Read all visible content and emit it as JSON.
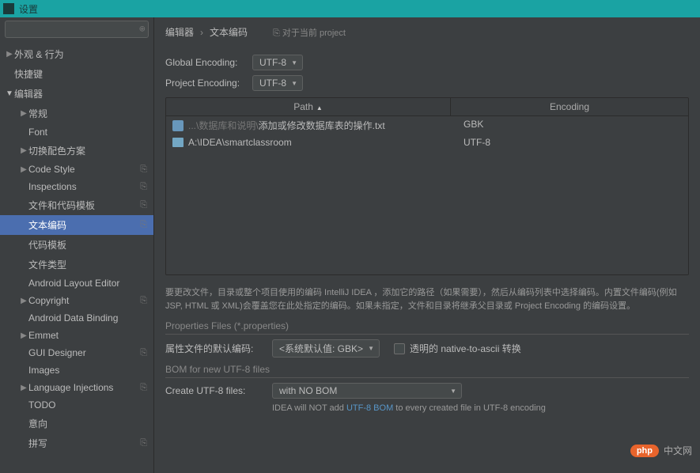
{
  "window": {
    "title": "设置"
  },
  "search": {
    "placeholder": ""
  },
  "tree": [
    {
      "label": "外观 & 行为",
      "level": 0,
      "expand": "right",
      "copy": false
    },
    {
      "label": "快捷键",
      "level": 0,
      "expand": "none",
      "copy": false
    },
    {
      "label": "编辑器",
      "level": 0,
      "expand": "down",
      "copy": false
    },
    {
      "label": "常规",
      "level": 1,
      "expand": "right",
      "copy": false
    },
    {
      "label": "Font",
      "level": 1,
      "expand": "none",
      "copy": false
    },
    {
      "label": "切换配色方案",
      "level": 1,
      "expand": "right",
      "copy": false
    },
    {
      "label": "Code Style",
      "level": 1,
      "expand": "right",
      "copy": true
    },
    {
      "label": "Inspections",
      "level": 1,
      "expand": "none",
      "copy": true
    },
    {
      "label": "文件和代码模板",
      "level": 1,
      "expand": "none",
      "copy": true
    },
    {
      "label": "文本编码",
      "level": 1,
      "expand": "none",
      "copy": true,
      "selected": true
    },
    {
      "label": "代码模板",
      "level": 1,
      "expand": "none",
      "copy": false
    },
    {
      "label": "文件类型",
      "level": 1,
      "expand": "none",
      "copy": false
    },
    {
      "label": "Android Layout Editor",
      "level": 1,
      "expand": "none",
      "copy": false
    },
    {
      "label": "Copyright",
      "level": 1,
      "expand": "right",
      "copy": true
    },
    {
      "label": "Android Data Binding",
      "level": 1,
      "expand": "none",
      "copy": false
    },
    {
      "label": "Emmet",
      "level": 1,
      "expand": "right",
      "copy": false
    },
    {
      "label": "GUI Designer",
      "level": 1,
      "expand": "none",
      "copy": true
    },
    {
      "label": "Images",
      "level": 1,
      "expand": "none",
      "copy": false
    },
    {
      "label": "Language Injections",
      "level": 1,
      "expand": "right",
      "copy": true
    },
    {
      "label": "TODO",
      "level": 1,
      "expand": "none",
      "copy": false
    },
    {
      "label": "意向",
      "level": 1,
      "expand": "none",
      "copy": false
    },
    {
      "label": "拼写",
      "level": 1,
      "expand": "none",
      "copy": true
    }
  ],
  "breadcrumb": {
    "root": "编辑器",
    "leaf": "文本编码",
    "scope": "对于当前 project"
  },
  "encodings": {
    "global_label": "Global Encoding:",
    "global_value": "UTF-8",
    "project_label": "Project Encoding:",
    "project_value": "UTF-8"
  },
  "table": {
    "col_path": "Path",
    "col_enc": "Encoding",
    "rows": [
      {
        "icon": "file",
        "prefix": "...\\数据库和说明\\",
        "name": "添加或修改数据库表的操作.txt",
        "enc": "GBK"
      },
      {
        "icon": "folder",
        "prefix": "",
        "name": "A:\\IDEA\\smartclassroom",
        "enc": "UTF-8"
      }
    ]
  },
  "hint": "要更改文件，目录或整个项目使用的编码 IntelliJ IDEA ，添加它的路径（如果需要），然后从编码列表中选择编码。内置文件编码(例如 JSP, HTML 或 XML)会覆盖您在此处指定的编码。如果未指定，文件和目录将继承父目录或 Project Encoding 的编码设置。",
  "properties": {
    "section": "Properties Files (*.properties)",
    "label": "属性文件的默认编码:",
    "value": "<系统默认值: GBK>",
    "checkbox_label": "透明的 native-to-ascii 转换"
  },
  "bom": {
    "section": "BOM for new UTF-8 files",
    "label": "Create UTF-8 files:",
    "value": "with NO BOM",
    "hint_pre": "IDEA will NOT add ",
    "hint_link": "UTF-8 BOM",
    "hint_post": " to every created file in UTF-8 encoding"
  },
  "watermark": {
    "badge": "php",
    "text": "中文网"
  }
}
